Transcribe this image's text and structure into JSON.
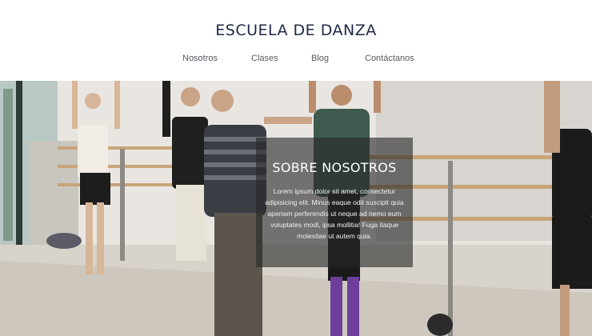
{
  "site": {
    "title": "ESCUELA DE DANZA"
  },
  "nav": {
    "items": [
      {
        "label": "Nosotros"
      },
      {
        "label": "Clases"
      },
      {
        "label": "Blog"
      },
      {
        "label": "Contáctanos"
      }
    ]
  },
  "hero": {
    "image_subject": "dancers-at-ballet-barre-photo",
    "overlay": {
      "title": "SOBRE NOSOTROS",
      "text": "Lorem ipsum dolor sit amet, consectetur adipisicing elit. Minus eaque odit suscipit quia aperiam perferendis ut neque ad nemo eum voluptates modi, ipsa mollitia! Fuga itaque molestiae ut autem quia."
    }
  },
  "colors": {
    "header_bg": "#ffffff",
    "title": "#1d2a44",
    "nav_text": "#555a63",
    "overlay_bg": "rgba(40,40,40,0.62)"
  }
}
